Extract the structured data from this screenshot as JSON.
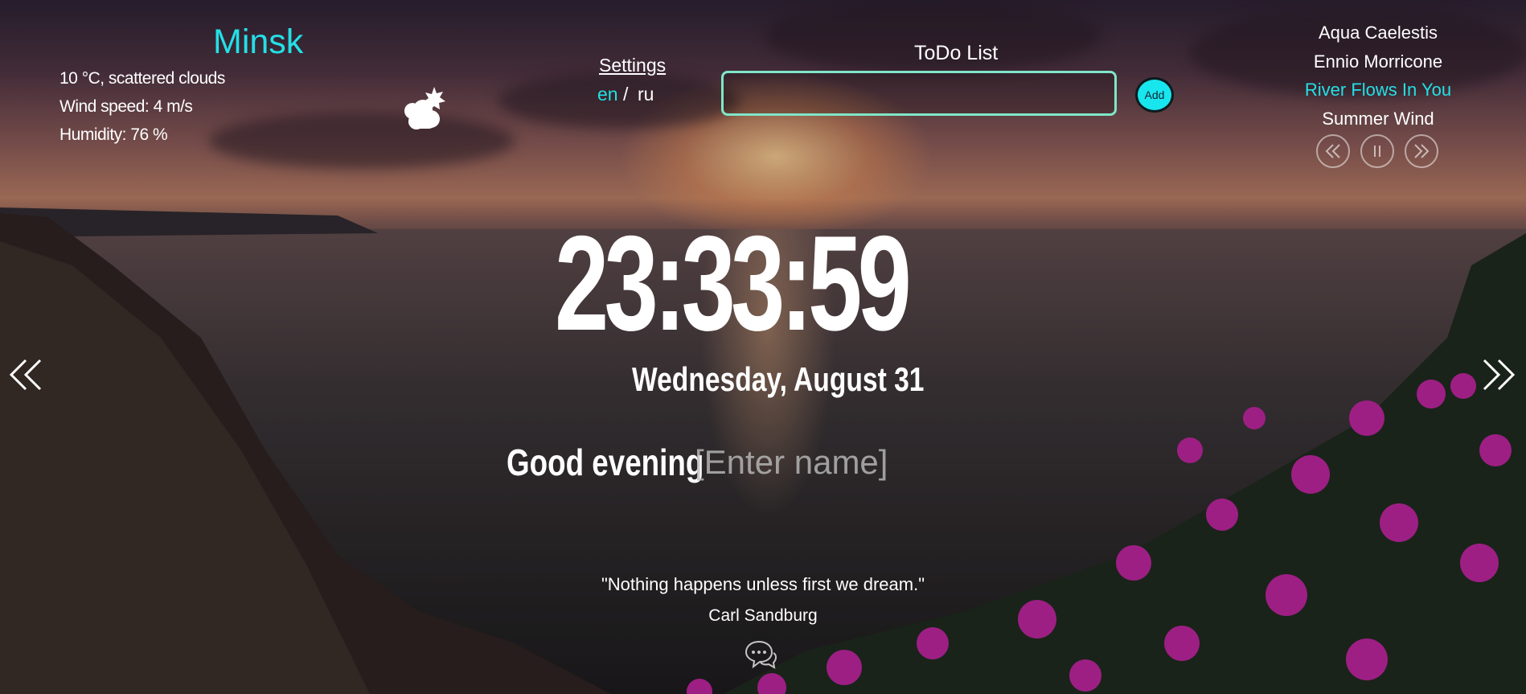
{
  "weather": {
    "city": "Minsk",
    "description": "10 °C, scattered clouds",
    "wind": "Wind speed: 4 m/s",
    "humidity": "Humidity: 76 %",
    "icon": "partly-cloudy-night-icon"
  },
  "settings": {
    "label": "Settings",
    "lang_en": "en",
    "lang_sep": "/",
    "lang_ru": "ru",
    "active_lang": "en"
  },
  "todo": {
    "title": "ToDo List",
    "input_value": "",
    "add_label": "Add"
  },
  "player": {
    "tracks": [
      "Aqua Caelestis",
      "Ennio Morricone",
      "River Flows In You",
      "Summer Wind"
    ],
    "active_index": 2,
    "controls": [
      "prev-icon",
      "pause-icon",
      "next-icon"
    ]
  },
  "clock": {
    "time": "23:33:59",
    "date": "Wednesday, August 31"
  },
  "greeting": {
    "text": "Good evening",
    "name_placeholder": "[Enter name]"
  },
  "quote": {
    "text": "\"Nothing happens unless first we dream.\"",
    "author": "Carl Sandburg"
  },
  "colors": {
    "accent": "#23e0e6",
    "todo_border": "#7fe6c8"
  }
}
